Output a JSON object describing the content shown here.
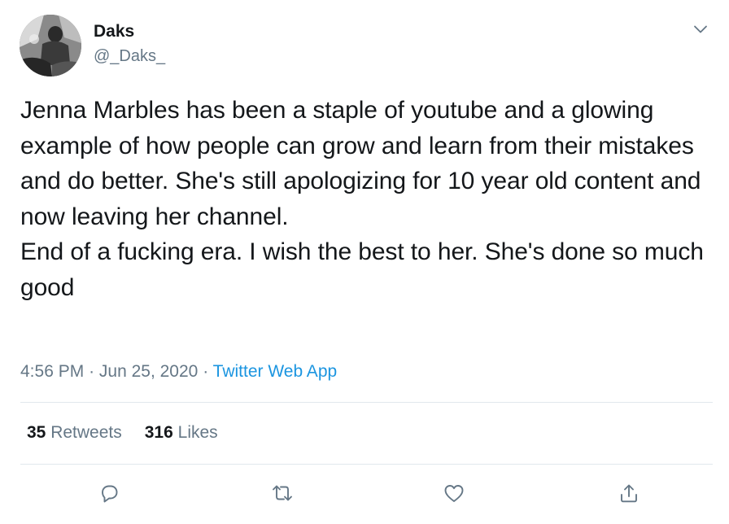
{
  "author": {
    "name": "Daks",
    "handle": "@_Daks_"
  },
  "tweet": {
    "text": "Jenna Marbles has been a staple of youtube and a glowing example of how people can grow and learn from their mistakes and do better. She's still apologizing for 10 year old content and now leaving her channel.\nEnd of a fucking era. I wish the best to her. She's done so much good",
    "time": "4:56 PM",
    "separator": "·",
    "date": "Jun 25, 2020",
    "source": "Twitter Web App"
  },
  "stats": {
    "retweets_count": "35",
    "retweets_label": "Retweets",
    "likes_count": "316",
    "likes_label": "Likes"
  },
  "icons": {
    "caret": "chevron-down-icon",
    "reply": "reply-icon",
    "retweet": "retweet-icon",
    "like": "heart-icon",
    "share": "share-icon"
  },
  "colors": {
    "text": "#14171a",
    "secondary": "#657786",
    "link": "#1b95e0",
    "divider": "#e1e8ed"
  }
}
